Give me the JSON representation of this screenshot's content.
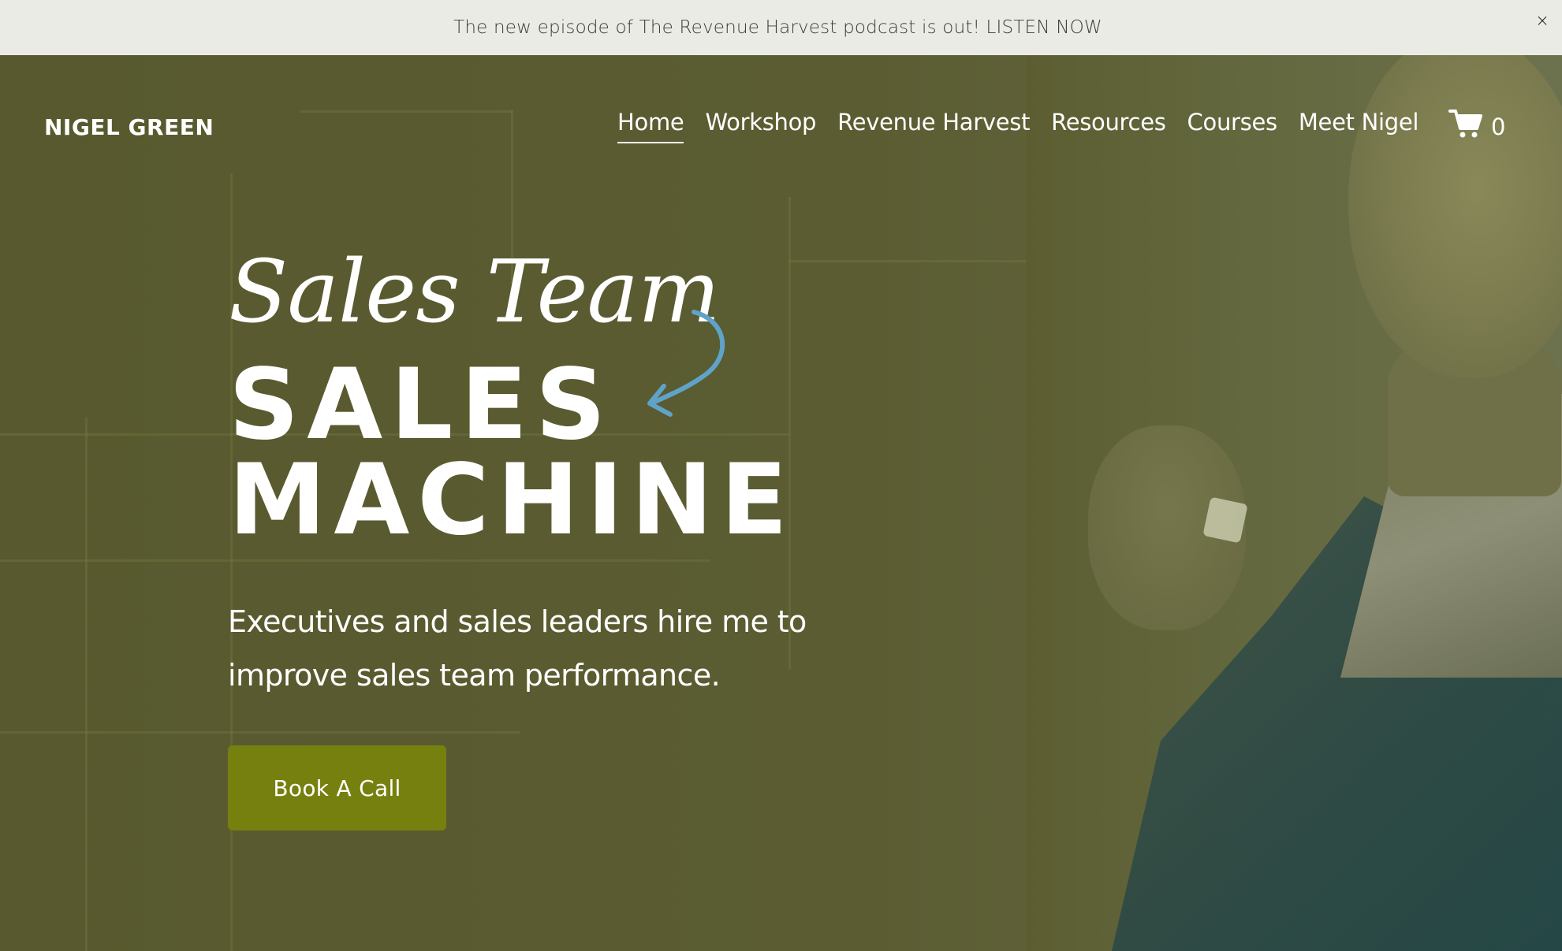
{
  "announcement": {
    "text": "The new episode of The Revenue Harvest podcast is out! LISTEN NOW",
    "close_label": "×"
  },
  "header": {
    "logo": "NIGEL GREEN",
    "nav": [
      {
        "label": "Home",
        "active": true
      },
      {
        "label": "Workshop",
        "active": false
      },
      {
        "label": "Revenue Harvest",
        "active": false
      },
      {
        "label": "Resources",
        "active": false
      },
      {
        "label": "Courses",
        "active": false
      },
      {
        "label": "Meet Nigel",
        "active": false
      }
    ],
    "cart": {
      "icon": "cart-icon",
      "count": "0"
    }
  },
  "hero": {
    "script_title": "Sales Team",
    "title_line1": "SALES",
    "title_line2": "MACHINE",
    "subtitle": "Executives and sales leaders hire me to improve sales team performance.",
    "cta_label": "Book A Call",
    "arrow_icon": "curved-arrow-icon"
  },
  "colors": {
    "announcement_bg": "#ebebe6",
    "hero_overlay": "#5a5c31",
    "cta_bg": "#76800f",
    "arrow": "#5fa3c8",
    "text": "#ffffff"
  }
}
